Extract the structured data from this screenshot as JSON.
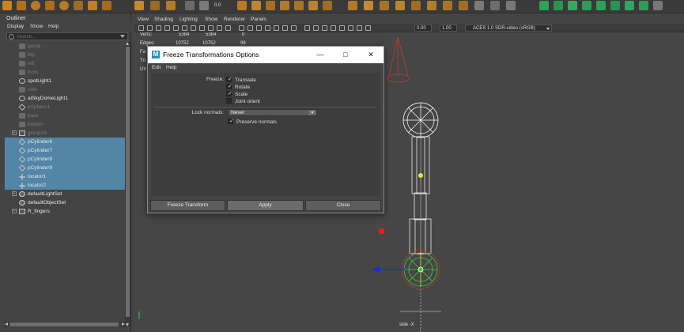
{
  "outliner": {
    "title": "Outliner",
    "menu": [
      "Display",
      "Show",
      "Help"
    ],
    "search_placeholder": "Search...",
    "items": [
      {
        "label": "persp",
        "icon": "camera-icon",
        "dim": true,
        "selected": false
      },
      {
        "label": "top",
        "icon": "camera-icon",
        "dim": true,
        "selected": false
      },
      {
        "label": "left",
        "icon": "camera-icon",
        "dim": true,
        "selected": false
      },
      {
        "label": "front",
        "icon": "camera-icon",
        "dim": true,
        "selected": false
      },
      {
        "label": "spotLight1",
        "icon": "spot-light-icon",
        "dim": false,
        "selected": false
      },
      {
        "label": "side",
        "icon": "camera-icon",
        "dim": true,
        "selected": false
      },
      {
        "label": "aiSkyDomeLight1",
        "icon": "sky-dome-light-icon",
        "dim": false,
        "selected": false
      },
      {
        "label": "pSphere1",
        "icon": "sphere-mesh-icon",
        "dim": true,
        "selected": false
      },
      {
        "label": "back",
        "icon": "camera-icon",
        "dim": true,
        "selected": false
      },
      {
        "label": "bottom",
        "icon": "camera-icon",
        "dim": true,
        "selected": false
      },
      {
        "label": "group18",
        "icon": "group-icon",
        "dim": true,
        "selected": false,
        "expandable": true
      },
      {
        "label": "pCylinder6",
        "icon": "mesh-icon",
        "dim": false,
        "selected": true
      },
      {
        "label": "pCylinder7",
        "icon": "mesh-icon",
        "dim": false,
        "selected": true
      },
      {
        "label": "pCylinder8",
        "icon": "mesh-icon",
        "dim": false,
        "selected": true
      },
      {
        "label": "pCylinder9",
        "icon": "mesh-icon",
        "dim": false,
        "selected": true
      },
      {
        "label": "locator1",
        "icon": "locator-icon",
        "dim": false,
        "selected": true
      },
      {
        "label": "locator2",
        "icon": "locator-icon",
        "dim": false,
        "selected": true
      },
      {
        "label": "defaultLightSet",
        "icon": "set-icon",
        "dim": false,
        "selected": false,
        "expandable": true
      },
      {
        "label": "defaultObjectSet",
        "icon": "set-icon",
        "dim": false,
        "selected": false
      },
      {
        "label": "R_fingers",
        "icon": "group-icon",
        "dim": false,
        "selected": false,
        "expandable": true
      }
    ]
  },
  "viewport": {
    "menu": [
      "View",
      "Shading",
      "Lighting",
      "Show",
      "Renderer",
      "Panels"
    ],
    "toolbar": {
      "field1": "0.00",
      "field2": "1.00",
      "color_space": "ACES 1.0 SDR-video (sRGB)"
    },
    "shelf_readout": "0.0",
    "hud": {
      "verts_label": "Verts:",
      "verts_a": "5384",
      "verts_b": "5384",
      "verts_c": "0",
      "edges_label": "Edges:",
      "edges_a": "10752",
      "edges_b": "10752",
      "edges_c": "96",
      "faces_label": "Fa",
      "tris_label": "Tri",
      "uvs_label": "UV"
    },
    "camera_label": "side -X"
  },
  "dialog": {
    "title": "Freeze Transformations Options",
    "menu": [
      "Edit",
      "Help"
    ],
    "freeze_label": "Freeze:",
    "options": [
      {
        "label": "Translate",
        "checked": true
      },
      {
        "label": "Rotate",
        "checked": true
      },
      {
        "label": "Scale",
        "checked": true
      },
      {
        "label": "Joint orient",
        "checked": false
      }
    ],
    "lock_normals_label": "Lock normals:",
    "lock_normals_value": "Never",
    "preserve_normals_label": "Preserve normals",
    "preserve_normals_checked": true,
    "buttons": {
      "freeze": "Freeze Transform",
      "apply": "Apply",
      "close": "Close"
    }
  },
  "colors": {
    "selection": "#5285a6",
    "spotlight_red": "#c0392b",
    "locator_green": "#3ccf3c",
    "manip_blue": "#1a2bd6",
    "highlight_yellow": "#e8e83a",
    "maya_logo": "#2a8fb7"
  }
}
